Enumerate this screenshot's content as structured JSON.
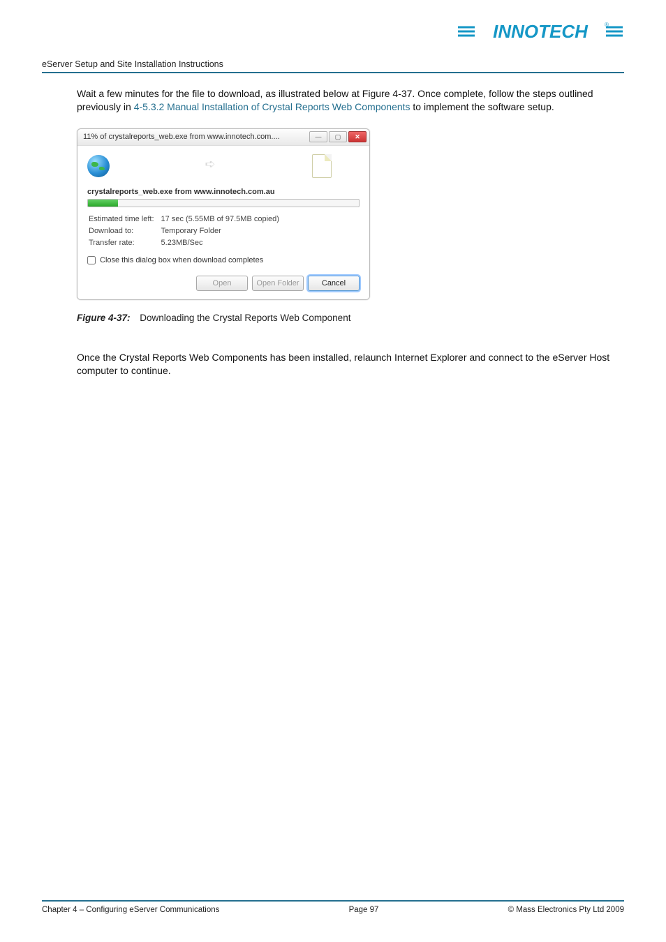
{
  "header": {
    "doc_title": "eServer Setup and Site Installation Instructions",
    "logo_text": "INNOTECH"
  },
  "para1": {
    "part1": "Wait a few minutes for the file to download, as illustrated below at Figure 4-37.  Once complete, follow the steps outlined previously in ",
    "link": "4-5.3.2 Manual Installation of Crystal Reports Web Components",
    "part2": " to implement the software setup."
  },
  "dialog": {
    "title": "11% of crystalreports_web.exe from www.innotech.com....",
    "file_line": "crystalreports_web.exe from www.innotech.com.au",
    "progress_percent": 11,
    "rows": {
      "est_label": "Estimated time left:",
      "est_value": "17 sec (5.55MB of 97.5MB copied)",
      "dl_label": "Download to:",
      "dl_value": "Temporary Folder",
      "tr_label": "Transfer rate:",
      "tr_value": "5.23MB/Sec"
    },
    "checkbox_label": "Close this dialog box when download completes",
    "buttons": {
      "open": "Open",
      "open_folder": "Open Folder",
      "cancel": "Cancel"
    }
  },
  "figure": {
    "label": "Figure 4-37:",
    "caption": "Downloading the Crystal Reports Web Component"
  },
  "para2": "Once the Crystal Reports Web Components has been installed, relaunch Internet Explorer and connect to the eServer Host computer to continue.",
  "footer": {
    "left": "Chapter 4 – Configuring eServer Communications",
    "center": "Page 97",
    "right": "©  Mass Electronics Pty Ltd  2009"
  }
}
